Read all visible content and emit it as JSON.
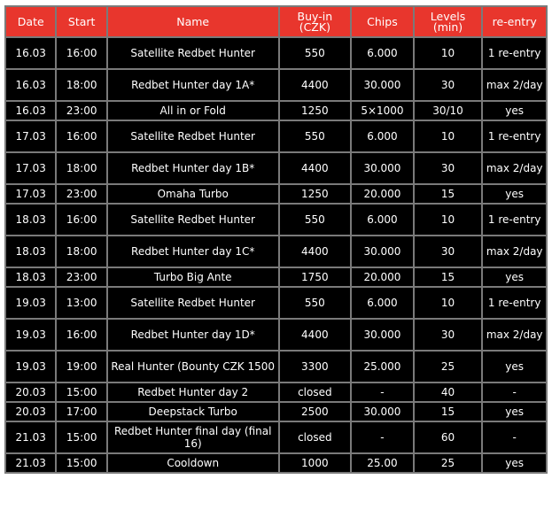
{
  "headers": {
    "date": "Date",
    "start": "Start",
    "name": "Name",
    "buyin_line1": "Buy-in",
    "buyin_line2": "(CZK)",
    "chips": "Chips",
    "levels_line1": "Levels",
    "levels_line2": "(min)",
    "reentry": "re-entry"
  },
  "rows": [
    {
      "date": "16.03",
      "start": "16:00",
      "name": "Satellite Redbet Hunter",
      "buyin": "550",
      "chips": "6.000",
      "levels": "10",
      "reentry": "1 re-entry"
    },
    {
      "date": "16.03",
      "start": "18:00",
      "name": "Redbet Hunter day 1A*",
      "buyin": "4400",
      "chips": "30.000",
      "levels": "30",
      "reentry": "max 2/day"
    },
    {
      "date": "16.03",
      "start": "23:00",
      "name": "All in or Fold",
      "buyin": "1250",
      "chips": "5×1000",
      "levels": "30/10",
      "reentry": "yes"
    },
    {
      "date": "17.03",
      "start": "16:00",
      "name": "Satellite Redbet Hunter",
      "buyin": "550",
      "chips": "6.000",
      "levels": "10",
      "reentry": "1 re-entry"
    },
    {
      "date": "17.03",
      "start": "18:00",
      "name": "Redbet Hunter day 1B*",
      "buyin": "4400",
      "chips": "30.000",
      "levels": "30",
      "reentry": "max 2/day"
    },
    {
      "date": "17.03",
      "start": "23:00",
      "name": "Omaha Turbo",
      "buyin": "1250",
      "chips": "20.000",
      "levels": "15",
      "reentry": "yes"
    },
    {
      "date": "18.03",
      "start": "16:00",
      "name": "Satellite Redbet Hunter",
      "buyin": "550",
      "chips": "6.000",
      "levels": "10",
      "reentry": "1 re-entry"
    },
    {
      "date": "18.03",
      "start": "18:00",
      "name": "Redbet Hunter day 1C*",
      "buyin": "4400",
      "chips": "30.000",
      "levels": "30",
      "reentry": "max 2/day"
    },
    {
      "date": "18.03",
      "start": "23:00",
      "name": "Turbo Big Ante",
      "buyin": "1750",
      "chips": "20.000",
      "levels": "15",
      "reentry": "yes"
    },
    {
      "date": "19.03",
      "start": "13:00",
      "name": "Satellite Redbet Hunter",
      "buyin": "550",
      "chips": "6.000",
      "levels": "10",
      "reentry": "1 re-entry"
    },
    {
      "date": "19.03",
      "start": "16:00",
      "name": "Redbet Hunter day 1D*",
      "buyin": "4400",
      "chips": "30.000",
      "levels": "30",
      "reentry": "max 2/day"
    },
    {
      "date": "19.03",
      "start": "19:00",
      "name": "Real Hunter (Bounty CZK 1500",
      "buyin": "3300",
      "chips": "25.000",
      "levels": "25",
      "reentry": "yes"
    },
    {
      "date": "20.03",
      "start": "15:00",
      "name": "Redbet Hunter day 2",
      "buyin": "closed",
      "chips": "-",
      "levels": "40",
      "reentry": "-"
    },
    {
      "date": "20.03",
      "start": "17:00",
      "name": "Deepstack Turbo",
      "buyin": "2500",
      "chips": "30.000",
      "levels": "15",
      "reentry": "yes"
    },
    {
      "date": "21.03",
      "start": "15:00",
      "name": "Redbet Hunter final day (final 16)",
      "buyin": "closed",
      "chips": "-",
      "levels": "60",
      "reentry": "-"
    },
    {
      "date": "21.03",
      "start": "15:00",
      "name": "Cooldown",
      "buyin": "1000",
      "chips": "25.00",
      "levels": "25",
      "reentry": "yes"
    }
  ]
}
